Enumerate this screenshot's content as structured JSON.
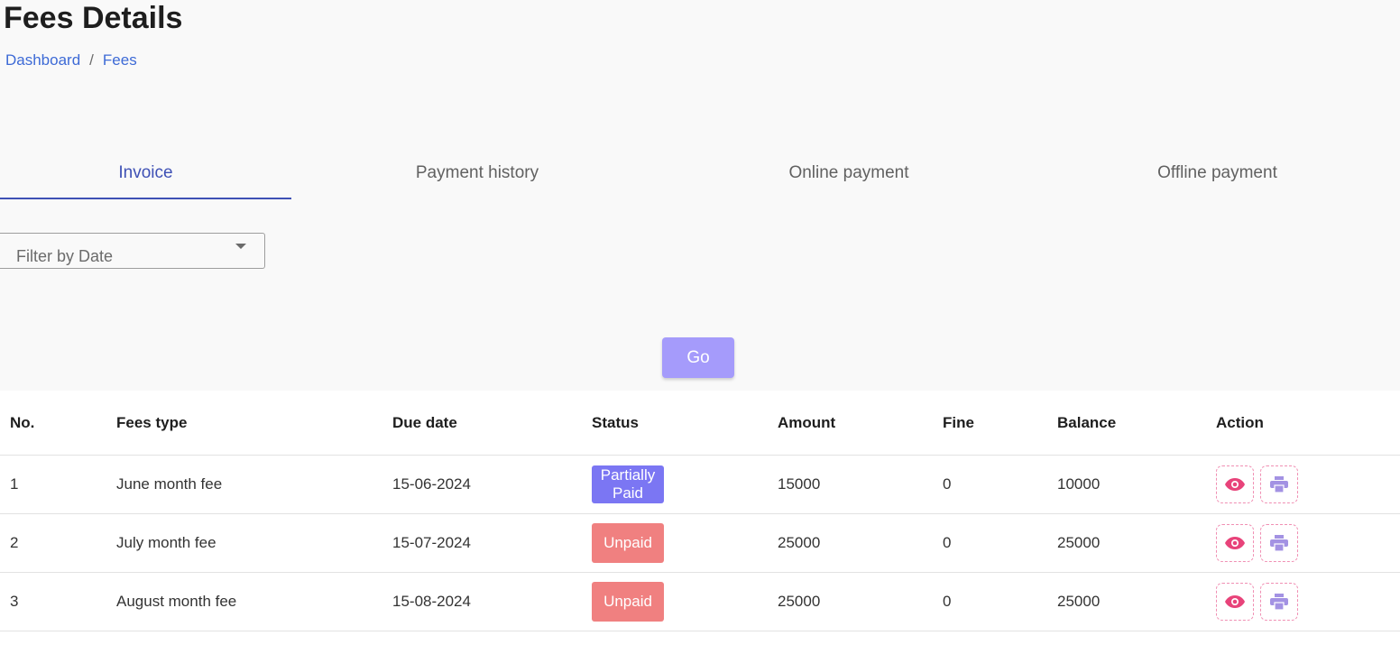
{
  "page": {
    "title": "Fees Details"
  },
  "breadcrumb": {
    "items": [
      "Dashboard",
      "Fees"
    ],
    "separator": "/"
  },
  "tabs": [
    {
      "label": "Invoice",
      "active": true
    },
    {
      "label": "Payment history",
      "active": false
    },
    {
      "label": "Online payment",
      "active": false
    },
    {
      "label": "Offline payment",
      "active": false
    }
  ],
  "filter": {
    "placeholder": "Filter by Date"
  },
  "go_button": {
    "label": "Go"
  },
  "table": {
    "headers": [
      "No.",
      "Fees type",
      "Due date",
      "Status",
      "Amount",
      "Fine",
      "Balance",
      "Action"
    ],
    "rows": [
      {
        "no": "1",
        "fees_type": "June month fee",
        "due_date": "15-06-2024",
        "status": "Partially Paid",
        "amount": "15000",
        "fine": "0",
        "balance": "10000"
      },
      {
        "no": "2",
        "fees_type": "July month fee",
        "due_date": "15-07-2024",
        "status": "Unpaid",
        "amount": "25000",
        "fine": "0",
        "balance": "25000"
      },
      {
        "no": "3",
        "fees_type": "August month fee",
        "due_date": "15-08-2024",
        "status": "Unpaid",
        "amount": "25000",
        "fine": "0",
        "balance": "25000"
      }
    ],
    "actions": [
      {
        "icon": "eye-icon",
        "color": "#e8437a"
      },
      {
        "icon": "printer-icon",
        "color": "#a392e3"
      }
    ]
  },
  "colors": {
    "accent": "#3f51b5",
    "link": "#3d6ad6",
    "go_button": "#a59bfb",
    "partially_paid": "#7b76f3",
    "unpaid": "#f08080"
  }
}
